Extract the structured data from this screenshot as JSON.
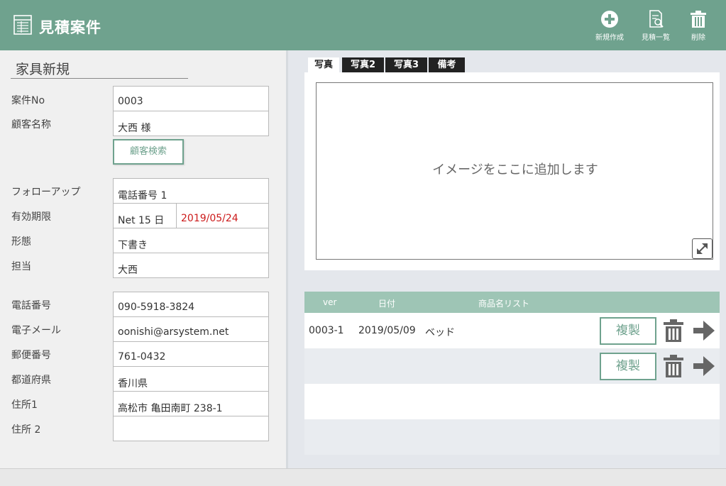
{
  "header": {
    "title": "見積案件",
    "app_icon": "table-icon",
    "tools": [
      {
        "label": "新規作成",
        "icon": "plus-circle-icon"
      },
      {
        "label": "見積一覧",
        "icon": "document-search-icon"
      },
      {
        "label": "削除",
        "icon": "trash-icon"
      }
    ]
  },
  "form": {
    "title": "家具新規",
    "case_no": {
      "label": "案件No",
      "value": "0003"
    },
    "customer_name": {
      "label": "顧客名称",
      "value": "大西 様"
    },
    "customer_search_button": "顧客検索",
    "follow_up": {
      "label": "フォローアップ",
      "value": "電話番号 1"
    },
    "valid_period": {
      "label": "有効期限",
      "terms": "Net 15 日",
      "date": "2019/05/24"
    },
    "form_type": {
      "label": "形態",
      "value": "下書き"
    },
    "assignee": {
      "label": "担当",
      "value": "大西"
    },
    "phone": {
      "label": "電話番号",
      "value": "090-5918-3824"
    },
    "email": {
      "label": "電子メール",
      "value": "oonishi@arsystem.net"
    },
    "postal_code": {
      "label": "郵便番号",
      "value": "761-0432"
    },
    "prefecture": {
      "label": "都道府県",
      "value": "香川県"
    },
    "address1": {
      "label": "住所1",
      "value": "高松市 亀田南町 238-1"
    },
    "address2": {
      "label": "住所 2",
      "value": ""
    }
  },
  "tabs": [
    {
      "label": "写真",
      "active": true
    },
    {
      "label": "写真2",
      "active": false
    },
    {
      "label": "写真3",
      "active": false
    },
    {
      "label": "備考",
      "active": false
    }
  ],
  "photo": {
    "placeholder": "イメージをここに追加します",
    "expand_icon": "expand-icon"
  },
  "versions_table": {
    "columns": [
      "ver",
      "日付",
      "商品名リスト"
    ],
    "rows": [
      {
        "ver": "0003-1",
        "date": "2019/05/09",
        "items": "ベッド",
        "copy_label": "複製"
      },
      {
        "ver": "",
        "date": "",
        "items": "",
        "copy_label": "複製"
      }
    ]
  },
  "colors": {
    "accent": "#6fa28e",
    "table_header": "#9ec5b5",
    "date_highlight": "#cc1a1a"
  }
}
